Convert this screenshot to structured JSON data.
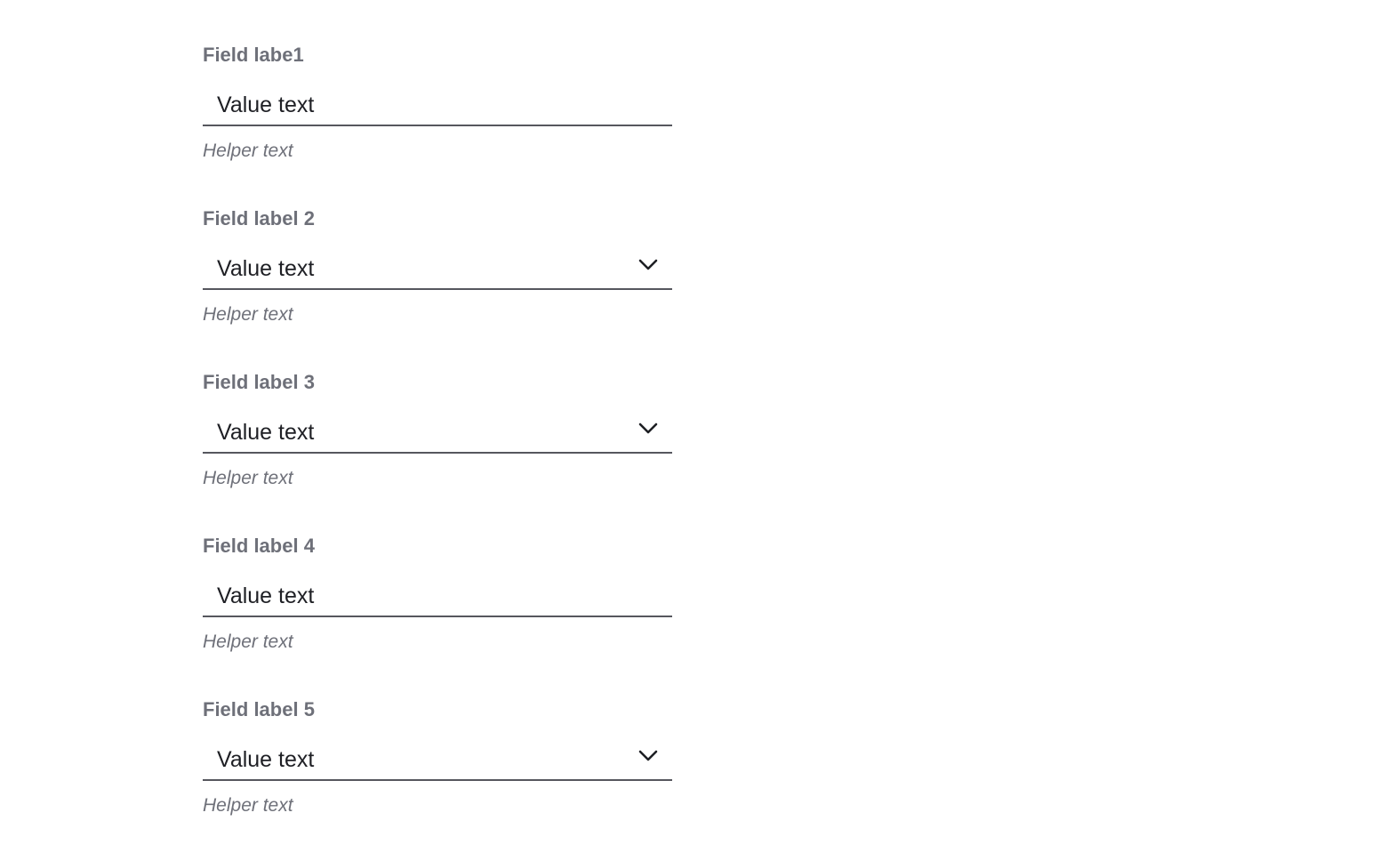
{
  "fields": [
    {
      "label": "Field labe1",
      "type": "text",
      "value": "Value text",
      "helper": "Helper text"
    },
    {
      "label": "Field label 2",
      "type": "select",
      "value": "Value text",
      "helper": "Helper text",
      "icon": "chevron-down-icon"
    },
    {
      "label": "Field label 3",
      "type": "select",
      "value": "Value text",
      "helper": "Helper text",
      "icon": "chevron-down-icon"
    },
    {
      "label": "Field label 4",
      "type": "text",
      "value": "Value text",
      "helper": "Helper text"
    },
    {
      "label": "Field label 5",
      "type": "select",
      "value": "Value text",
      "helper": "Helper text",
      "icon": "chevron-down-icon"
    }
  ],
  "colors": {
    "label": "#6e7079",
    "value": "#1e1f24",
    "underline": "#56575e",
    "helper": "#6e7079",
    "background": "#ffffff"
  }
}
